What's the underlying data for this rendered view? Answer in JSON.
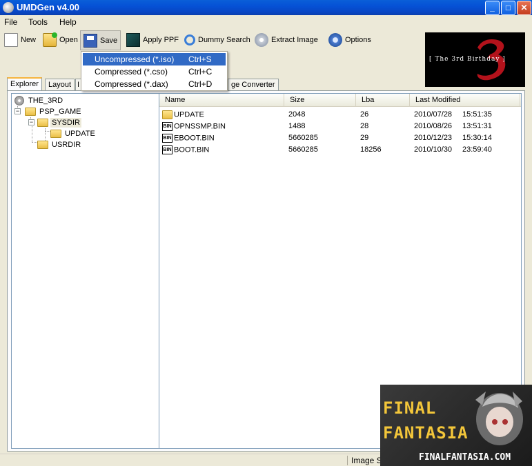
{
  "window": {
    "title": "UMDGen v4.00"
  },
  "menu": [
    "File",
    "Tools",
    "Help"
  ],
  "toolbar": {
    "new": "New",
    "open": "Open",
    "save": "Save",
    "apply_ppf": "Apply PPF",
    "dummy_search": "Dummy Search",
    "extract_image": "Extract Image",
    "options": "Options"
  },
  "save_menu": [
    {
      "label": "Uncompressed (*.iso)",
      "shortcut": "Ctrl+S",
      "highlighted": true
    },
    {
      "label": "Compressed (*.cso)",
      "shortcut": "Ctrl+C"
    },
    {
      "label": "Compressed (*.dax)",
      "shortcut": "Ctrl+D"
    }
  ],
  "logo": {
    "text": "[ The 3rd Birthday ]"
  },
  "tabs": [
    "Explorer",
    "Layout",
    "I",
    "ge Converter"
  ],
  "tree": {
    "root": "THE_3RD",
    "items": [
      "PSP_GAME",
      "SYSDIR",
      "UPDATE",
      "USRDIR"
    ]
  },
  "list": {
    "columns": [
      "Name",
      "Size",
      "Lba",
      "Last Modified"
    ],
    "rows": [
      {
        "icon": "folder-icon",
        "name": "UPDATE",
        "size": "2048",
        "lba": "26",
        "date": "2010/07/28",
        "time": "15:51:35"
      },
      {
        "icon": "bin-icon",
        "name": "OPNSSMP.BIN",
        "size": "1488",
        "lba": "28",
        "date": "2010/08/26",
        "time": "13:51:31"
      },
      {
        "icon": "bin-icon",
        "name": "EBOOT.BIN",
        "size": "5660285",
        "lba": "29",
        "date": "2010/12/23",
        "time": "15:30:14"
      },
      {
        "icon": "bin-icon",
        "name": "BOOT.BIN",
        "size": "5660285",
        "lba": "18256",
        "date": "2010/10/30",
        "time": "23:59:40"
      }
    ],
    "bin_badge": "BIN"
  },
  "status": {
    "image_size": "Image Size: 1323"
  },
  "watermark": {
    "line1": "FINAL",
    "line2": "FANTASIA",
    "url": "FINALFANTASIA.COM"
  },
  "colors": {
    "titlebar": "#0551d6",
    "highlight": "#316ac5",
    "tab_accent": "#f6b43e",
    "logo_red": "#b3121b",
    "watermark_gold": "#f3c63a"
  }
}
